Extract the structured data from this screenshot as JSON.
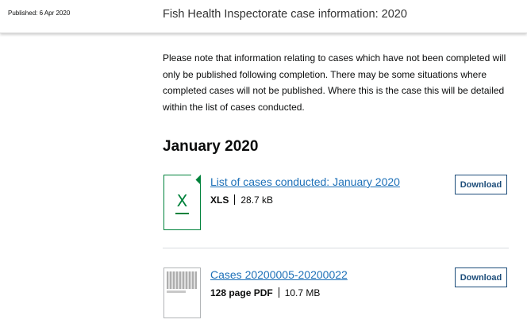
{
  "header": {
    "published": "Published: 6 Apr 2020",
    "title": "Fish Health Inspectorate case information: 2020"
  },
  "notice": "Please note that information relating to cases which have not been completed will only be published following completion. There may be some situations where completed cases will not be published. Where this is the case this will be detailed within the list of cases conducted.",
  "section": {
    "heading": "January 2020"
  },
  "attachments": [
    {
      "title": "List of cases conducted: January 2020",
      "format": "XLS",
      "size": "28.7 kB",
      "download_label": "Download",
      "thumbnail_icon": "spreadsheet-x-icon"
    },
    {
      "title": "Cases 20200005-20200022",
      "format": "128 page PDF",
      "size": "10.7 MB",
      "download_label": "Download",
      "thumbnail_icon": "pdf-page-preview"
    }
  ],
  "colors": {
    "link": "#1d70b8",
    "xls_green": "#00823b",
    "button_border": "#1d4d7a"
  }
}
